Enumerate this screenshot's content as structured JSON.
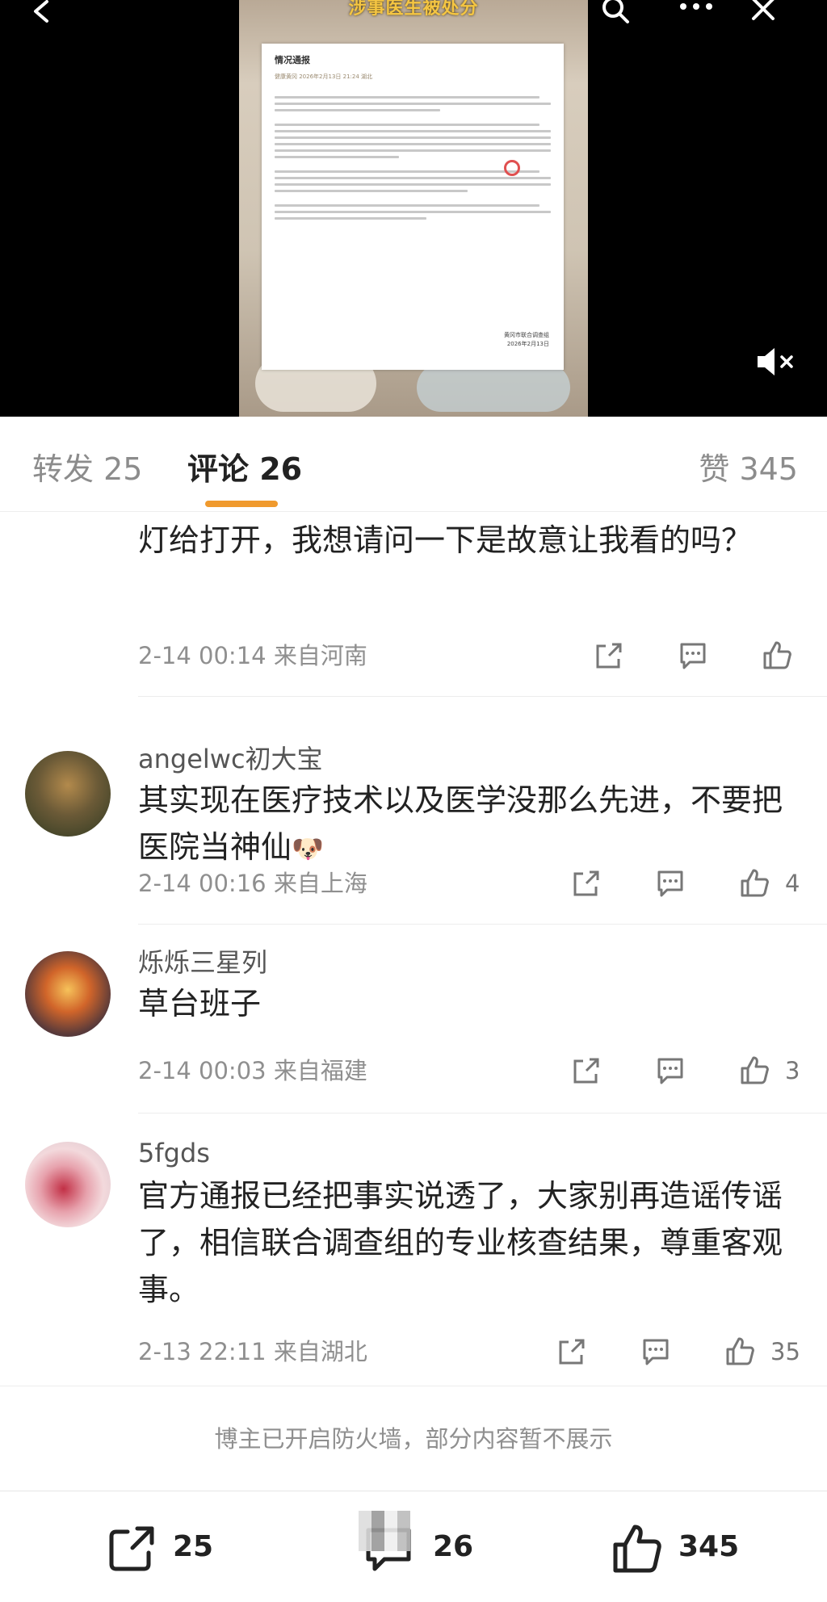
{
  "video": {
    "overlay_title": "涉事医生被处分",
    "notice_title": "情况通报",
    "notice_meta": "健康黄冈  2026年2月13日 21:24  湖北",
    "notice_signer": "黄冈市联合调查组",
    "notice_date": "2026年2月13日"
  },
  "tabs": {
    "reposts": "转发 25",
    "comments": "评论 26",
    "likes": "赞 345"
  },
  "comments": [
    {
      "username": "",
      "text": "市紊河小学的精神病人教师故意把右边教学楼的灯给打开，我想请问一下是故意让我看的吗？",
      "meta": "2-14 00:14 来自河南",
      "like_count": ""
    },
    {
      "username": "angelwc初大宝",
      "text": "其实现在医疗技术以及医学没那么先进，不要把医院当神仙",
      "emoji": "🐶",
      "meta": "2-14 00:16 来自上海",
      "like_count": "4"
    },
    {
      "username": "烁烁三星列",
      "text": "草台班子",
      "meta": "2-14 00:03 来自福建",
      "like_count": "3"
    },
    {
      "username": "5fgds",
      "text": "官方通报已经把事实说透了，大家别再造谣传谣了，相信联合调查组的专业核查结果，尊重客观事。",
      "meta": "2-13 22:11 来自湖北",
      "like_count": "35"
    }
  ],
  "firewall_notice": "博主已开启防火墙，部分内容暂不展示",
  "bottom_bar": {
    "reposts": "25",
    "comments": "26",
    "likes": "345"
  },
  "icons": [
    "back-icon",
    "search-icon",
    "more-icon",
    "close-icon",
    "mute-icon",
    "share-icon",
    "comment-icon",
    "like-icon"
  ],
  "colors": {
    "accent": "#f09a2e",
    "video_title": "#f4c542",
    "muted_text": "#8f8f8f"
  }
}
